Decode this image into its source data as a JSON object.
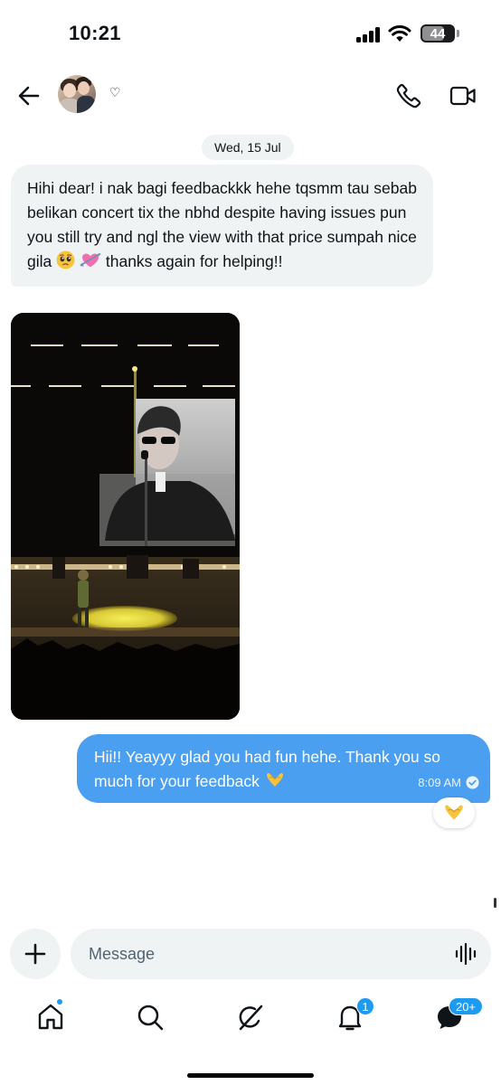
{
  "status_bar": {
    "time": "10:21",
    "battery": "44"
  },
  "header": {
    "display_name": "♡"
  },
  "conversation": {
    "date": "Wed, 15 Jul",
    "received": {
      "text_before_emoji": "Hihi dear! i nak bagi feedbackkk hehe tqsmm tau sebab belikan concert tix the nbhd despite having issues pun you still try and ngl the view with that price sumpah nice gila",
      "emojis": [
        "pleading-face-emoji",
        "heart-with-arrow-emoji"
      ],
      "text_after_emoji": " thanks again for helping!!"
    },
    "sent": {
      "text": "Hii!! Yeayyy glad you had fun hehe. Thank you so much for your feedback",
      "time": "8:09 AM",
      "status": "read",
      "reaction": "heart-hands-emoji"
    }
  },
  "composer": {
    "placeholder": "Message"
  },
  "tabbar": {
    "items": [
      {
        "name": "home",
        "icon": "home-icon"
      },
      {
        "name": "search",
        "icon": "search-icon"
      },
      {
        "name": "grok",
        "icon": "grok-icon"
      },
      {
        "name": "notifications",
        "icon": "bell-icon",
        "badge": "1"
      },
      {
        "name": "messages",
        "icon": "envelope-icon",
        "badge": "20+"
      }
    ]
  },
  "colors": {
    "accent": "#1d9bf0",
    "sent_bubble": "#4a9ff0",
    "received_bubble": "#eff3f4"
  }
}
